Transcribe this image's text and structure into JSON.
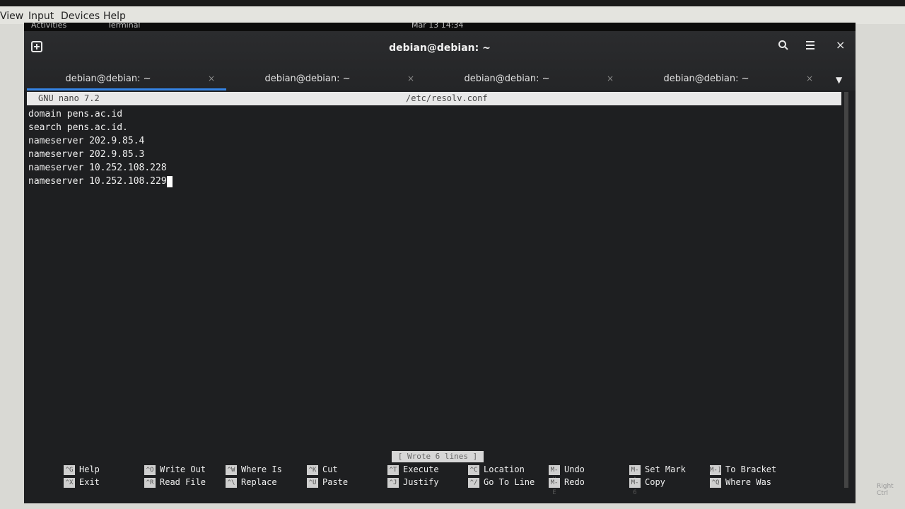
{
  "host": {
    "menus": [
      "View",
      "Input",
      "Devices",
      "Help"
    ],
    "status_right": "Right Ctrl"
  },
  "gnome": {
    "activities": "Activities",
    "app": "Terminal",
    "clock": "Mar 13 14:34"
  },
  "terminal": {
    "title": "debian@debian: ~",
    "new_tab_icon": "plus-square-icon",
    "tabs": [
      {
        "label": "debian@debian: ~",
        "close": "×"
      },
      {
        "label": "debian@debian: ~",
        "close": "×"
      },
      {
        "label": "debian@debian: ~",
        "close": "×"
      },
      {
        "label": "debian@debian: ~",
        "close": "×"
      }
    ],
    "tabs_menu_icon": "▼",
    "search_icon": "⌕",
    "menu_icon": "≡",
    "close_icon": "×"
  },
  "nano": {
    "version": "GNU nano 7.2",
    "filename": "/etc/resolv.conf",
    "lines": [
      "domain pens.ac.id",
      "search pens.ac.id.",
      "nameserver 202.9.85.4",
      "nameserver 202.9.85.3",
      "nameserver 10.252.108.228",
      "nameserver 10.252.108.229"
    ],
    "status": "[ Wrote 6 lines ]",
    "shortcuts_row1": [
      {
        "key": "^G",
        "label": "Help"
      },
      {
        "key": "^O",
        "label": "Write Out"
      },
      {
        "key": "^W",
        "label": "Where Is"
      },
      {
        "key": "^K",
        "label": "Cut"
      },
      {
        "key": "^T",
        "label": "Execute"
      },
      {
        "key": "^C",
        "label": "Location"
      },
      {
        "key": "M-U",
        "label": "Undo"
      },
      {
        "key": "M-A",
        "label": "Set Mark"
      },
      {
        "key": "M-]",
        "label": "To Bracket"
      }
    ],
    "shortcuts_row2": [
      {
        "key": "^X",
        "label": "Exit"
      },
      {
        "key": "^R",
        "label": "Read File"
      },
      {
        "key": "^\\",
        "label": "Replace"
      },
      {
        "key": "^U",
        "label": "Paste"
      },
      {
        "key": "^J",
        "label": "Justify"
      },
      {
        "key": "^/",
        "label": "Go To Line"
      },
      {
        "key": "M-E",
        "label": "Redo"
      },
      {
        "key": "M-6",
        "label": "Copy"
      },
      {
        "key": "^Q",
        "label": "Where Was"
      }
    ]
  }
}
